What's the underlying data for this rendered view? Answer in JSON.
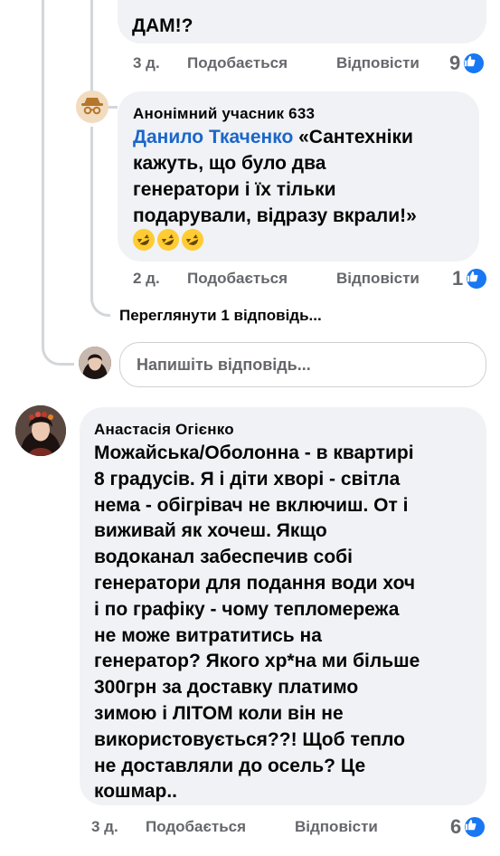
{
  "comment_top": {
    "text_tail": "ДАМ!?",
    "time": "3 д.",
    "like_label": "Подобається",
    "reply_label": "Відповісти",
    "like_count": "9"
  },
  "reply_anon": {
    "author": "Анонімний учасник 633",
    "mention": "Данило Ткаченко",
    "text_line1": " «Сантехніки",
    "text_line2": "кажуть, що було два",
    "text_line3": "генератори і їх тільки",
    "text_line4": "подарували, відразу вкрали!»",
    "emojis": [
      "🤣",
      "🤣",
      "🤣"
    ],
    "time": "2 д.",
    "like_label": "Подобається",
    "reply_label": "Відповісти",
    "like_count": "1"
  },
  "view_replies": "Переглянути 1 відповідь...",
  "reply_input": {
    "placeholder": "Напишіть відповідь..."
  },
  "comment_main": {
    "author": "Анастасія Огієнко",
    "lines": [
      "Можайська/Оболонна - в квартирі",
      "8 градусів. Я і діти хворі - світла",
      "нема - обігрівач не включиш. От і",
      "виживай як хочеш. Якщо",
      "водоканал забеспечив собі",
      "генератори для подання води хоч",
      "і по графіку - чому тепломережа",
      "не може витратитись на",
      "генератор? Якого хр*на ми більше",
      "300грн за доставку платимо",
      "зимою і ЛІТОМ коли він не",
      "використовується??! Щоб тепло",
      "не доставляли до осель? Це",
      "кошмар.."
    ],
    "time": "3 д.",
    "like_label": "Подобається",
    "reply_label": "Відповісти",
    "like_count": "6"
  },
  "colors": {
    "bubble": "#f0f2f5",
    "mention": "#1b66c9",
    "like_blue": "#1877f2",
    "muted": "#65676b"
  }
}
